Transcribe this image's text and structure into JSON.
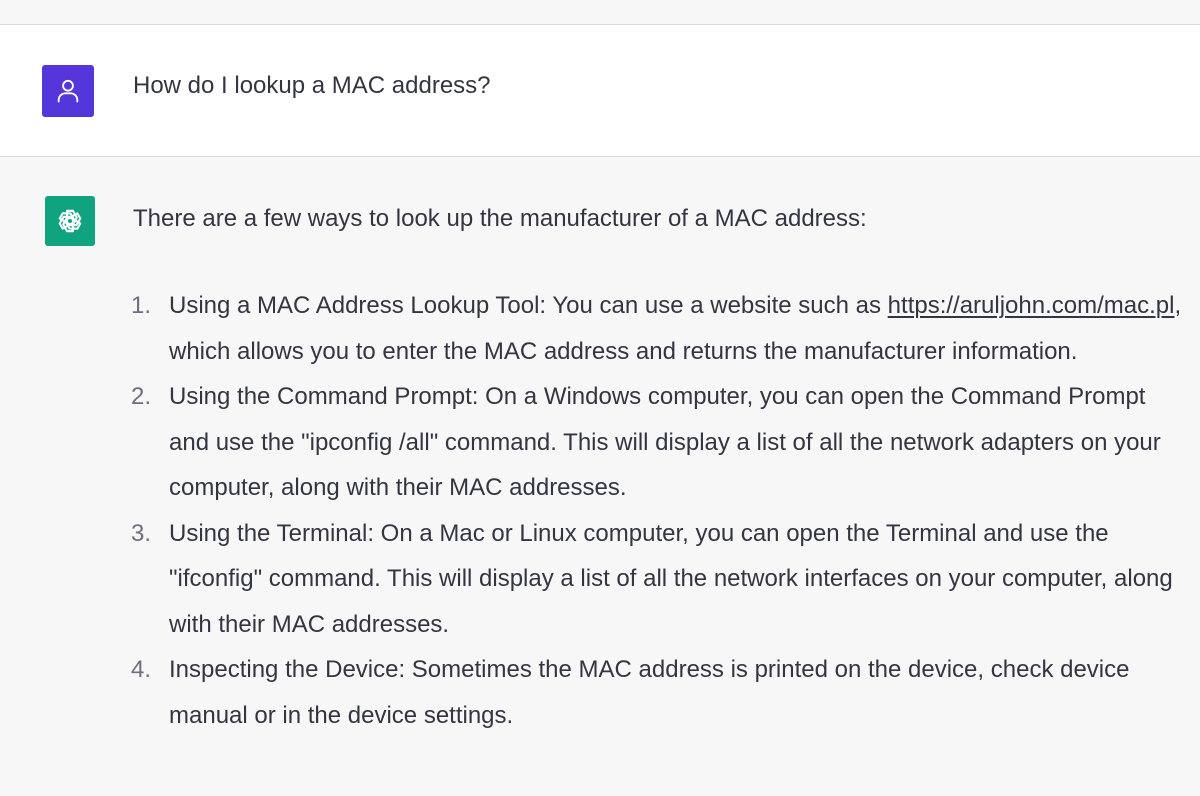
{
  "user_message": {
    "text": "How do I lookup a MAC address?",
    "avatar_icon": "user-icon",
    "avatar_color": "#5436da"
  },
  "assistant_message": {
    "avatar_icon": "openai-logo-icon",
    "avatar_color": "#10a37f",
    "intro": "There are a few ways to look up the manufacturer of a MAC address:",
    "items": [
      {
        "number": "1.",
        "text_before": "Using a MAC Address Lookup Tool: You can use a website such as ",
        "link": "https://aruljohn.com/mac.pl",
        "text_after": ", which allows you to enter the MAC address and returns the manufacturer information."
      },
      {
        "number": "2.",
        "text": "Using the Command Prompt: On a Windows computer, you can open the Command Prompt and use the \"ipconfig /all\" command. This will display a list of all the network adapters on your computer, along with their MAC addresses."
      },
      {
        "number": "3.",
        "text": "Using the Terminal: On a Mac or Linux computer, you can open the Terminal and use the \"ifconfig\" command. This will display a list of all the network interfaces on your computer, along with their MAC addresses."
      },
      {
        "number": "4.",
        "text": "Inspecting the Device: Sometimes the MAC address is printed on the device, check device manual or in the device settings."
      }
    ]
  }
}
